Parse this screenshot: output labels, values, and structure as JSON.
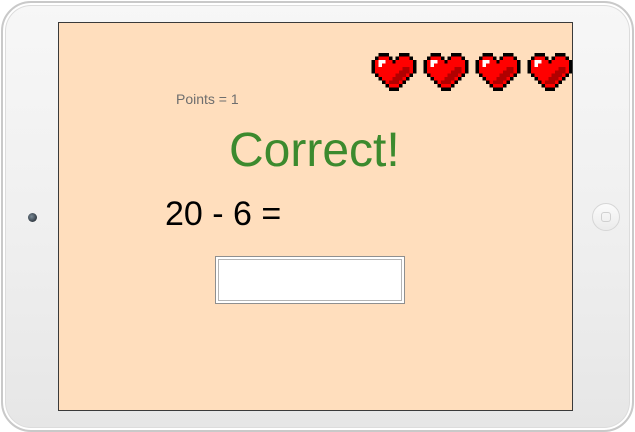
{
  "game": {
    "points_text": "Points = 1",
    "feedback_text": "Correct!",
    "question_text": "20 - 6 =",
    "answer_value": "",
    "lives": 4,
    "heart_icon": "heart-icon"
  },
  "colors": {
    "screen_background": "#ffdebd",
    "feedback_green": "#3c8a2e",
    "heart_red": "#ff0000"
  }
}
